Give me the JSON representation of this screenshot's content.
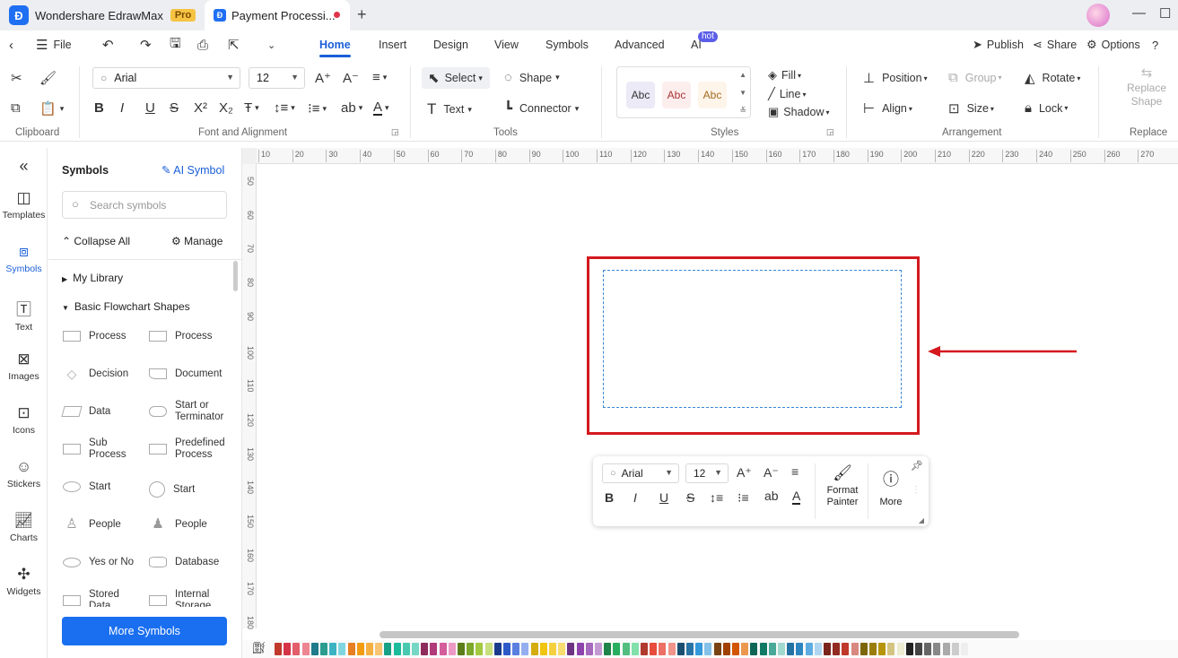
{
  "title_bar": {
    "app_name": "Wondershare EdrawMax",
    "app_badge": "Pro",
    "doc_tab": "Payment Processi...",
    "new_tab": "+"
  },
  "menu": {
    "file": "File",
    "tabs": [
      "Home",
      "Insert",
      "Design",
      "View",
      "Symbols",
      "Advanced",
      "AI"
    ],
    "ai_badge": "hot",
    "publish": "Publish",
    "share": "Share",
    "options": "Options"
  },
  "ribbon": {
    "font_name": "Arial",
    "font_size": "12",
    "select": "Select",
    "shape": "Shape",
    "text": "Text",
    "connector": "Connector",
    "style_samples": [
      "Abc",
      "Abc",
      "Abc"
    ],
    "fill": "Fill",
    "line": "Line",
    "shadow": "Shadow",
    "position": "Position",
    "group": "Group",
    "rotate": "Rotate",
    "align": "Align",
    "size": "Size",
    "lock": "Lock",
    "replace_shape_1": "Replace",
    "replace_shape_2": "Shape",
    "groups": {
      "clipboard": "Clipboard",
      "font": "Font and Alignment",
      "tools": "Tools",
      "styles": "Styles",
      "arrangement": "Arrangement",
      "replace": "Replace"
    }
  },
  "left_nav": [
    "Templates",
    "Symbols",
    "Text",
    "Images",
    "Icons",
    "Stickers",
    "Charts",
    "Widgets"
  ],
  "panel": {
    "title": "Symbols",
    "ai_symbol": "AI Symbol",
    "search_placeholder": "Search symbols",
    "collapse_all": "Collapse All",
    "manage": "Manage",
    "my_library": "My Library",
    "category": "Basic Flowchart Shapes",
    "shapes": [
      [
        "Process",
        "Process"
      ],
      [
        "Decision",
        "Document"
      ],
      [
        "Data",
        "Start or Terminator"
      ],
      [
        "Sub Process",
        "Predefined Process"
      ],
      [
        "Start",
        "Start"
      ],
      [
        "People",
        "People"
      ],
      [
        "Yes or No",
        "Database"
      ],
      [
        "Stored Data",
        "Internal Storage"
      ]
    ],
    "more_symbols": "More Symbols"
  },
  "ruler": {
    "h": [
      "10",
      "20",
      "30",
      "40",
      "50",
      "60",
      "70",
      "80",
      "90",
      "100",
      "110",
      "120",
      "130",
      "140",
      "150",
      "160",
      "170",
      "180",
      "190",
      "200",
      "210",
      "220",
      "230",
      "240",
      "250",
      "260",
      "270"
    ],
    "v": [
      "50",
      "60",
      "70",
      "80",
      "90",
      "100",
      "110",
      "120",
      "130",
      "140",
      "150",
      "160",
      "170",
      "180"
    ]
  },
  "float_toolbar": {
    "font_name": "Arial",
    "font_size": "12",
    "format_painter_1": "Format",
    "format_painter_2": "Painter",
    "more": "More"
  },
  "colors": {
    "accent": "#1a5fd8",
    "highlight": "#d4191f",
    "palette": [
      "#c0392b",
      "#d63447",
      "#e35d6a",
      "#ee8593",
      "#1f7a8c",
      "#2a9d8f",
      "#3bb3c3",
      "#7fd6e0",
      "#e67e22",
      "#f39c12",
      "#f5b041",
      "#f8c471",
      "#16a085",
      "#1abc9c",
      "#48c9b0",
      "#76d7c4",
      "#8e2c5c",
      "#b03a7a",
      "#d45d9b",
      "#ec9ac5",
      "#5a7d1a",
      "#7ca82b",
      "#a3c940",
      "#c7df7d",
      "#1a3a8c",
      "#2e5ac9",
      "#5b7fe0",
      "#94aef0",
      "#d4ac0d",
      "#f1c40f",
      "#f4d03f",
      "#f7dc6f",
      "#6c3483",
      "#8e44ad",
      "#a569bd",
      "#c39bd3",
      "#1e8449",
      "#27ae60",
      "#52be80",
      "#82e0aa",
      "#b03a2e",
      "#e74c3c",
      "#ec7063",
      "#f1948a",
      "#1b4f72",
      "#2874a6",
      "#3498db",
      "#85c1e9",
      "#784212",
      "#a04000",
      "#d35400",
      "#eb984e",
      "#0e6655",
      "#117a65",
      "#48a999",
      "#a2d9ce",
      "#2471a3",
      "#2e86c1",
      "#5dade2",
      "#aed6f1",
      "#7b241c",
      "#922b21",
      "#c0392b",
      "#d98880",
      "#7d6608",
      "#9a7d0a",
      "#b7950b",
      "#d4c481",
      "#edebd0",
      "#222222",
      "#444444",
      "#666666",
      "#888888",
      "#aaaaaa",
      "#cccccc",
      "#eeeeee"
    ]
  }
}
